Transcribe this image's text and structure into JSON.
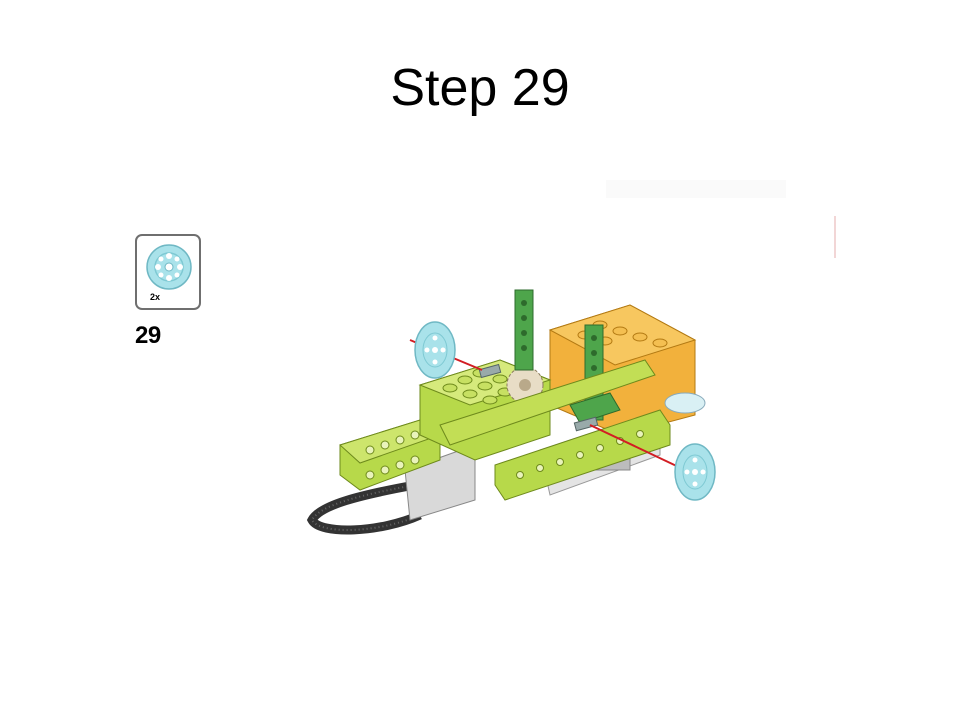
{
  "slide": {
    "title": "Step 29"
  },
  "instruction": {
    "step_number": "29",
    "parts": [
      {
        "quantity": "2x",
        "part": "wheel-icon"
      }
    ]
  },
  "colors": {
    "lime": "#b7d94a",
    "dark_green": "#4ea54b",
    "orange": "#f2b13c",
    "wheel_blue": "#a9e2ea",
    "arrow_red": "#d21d23",
    "box_border": "#6f6f6f"
  }
}
